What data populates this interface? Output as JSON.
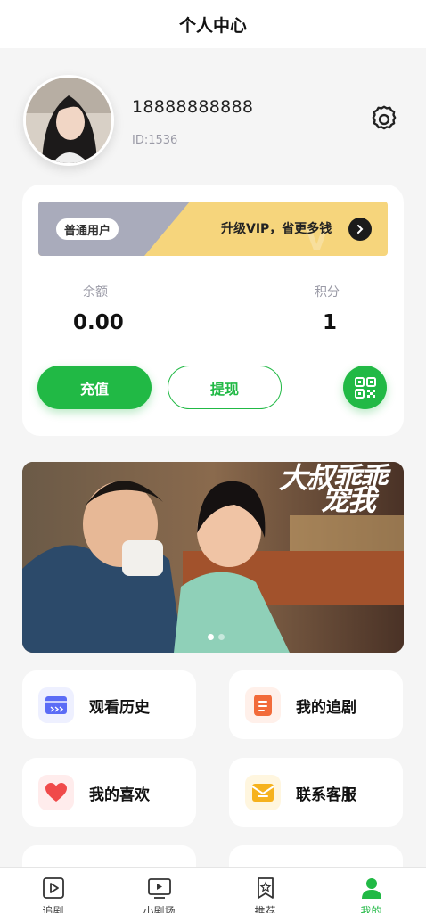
{
  "header": {
    "title": "个人中心"
  },
  "profile": {
    "phone": "18888888888",
    "id_text": "ID:1536"
  },
  "account": {
    "vip_badge": "普通用户",
    "vip_promo": "升级VIP，省更多钱",
    "balance_label": "余额",
    "balance_value": "0.00",
    "points_label": "积分",
    "points_value": "1",
    "recharge_label": "充值",
    "withdraw_label": "提现"
  },
  "banner": {
    "title_line1": "大叔乖乖",
    "title_line2": "宠我",
    "dots": 2,
    "active_dot": 0
  },
  "menu": [
    {
      "label": "观看历史",
      "icon": "history-icon",
      "color": "#5b6cf6"
    },
    {
      "label": "我的追剧",
      "icon": "follow-list-icon",
      "color": "#f26b3a"
    },
    {
      "label": "我的喜欢",
      "icon": "heart-icon",
      "color": "#f04a4a"
    },
    {
      "label": "联系客服",
      "icon": "customer-service-icon",
      "color": "#f6b21e"
    }
  ],
  "tabbar": [
    {
      "label": "追剧",
      "icon": "play-square-icon"
    },
    {
      "label": "小剧场",
      "icon": "tv-icon"
    },
    {
      "label": "推荐",
      "icon": "star-bookmark-icon"
    },
    {
      "label": "我的",
      "icon": "user-icon",
      "active": true
    }
  ],
  "colors": {
    "accent": "#21b945",
    "vip_gold": "#f6d57c",
    "vip_gray": "#a9abbb"
  }
}
